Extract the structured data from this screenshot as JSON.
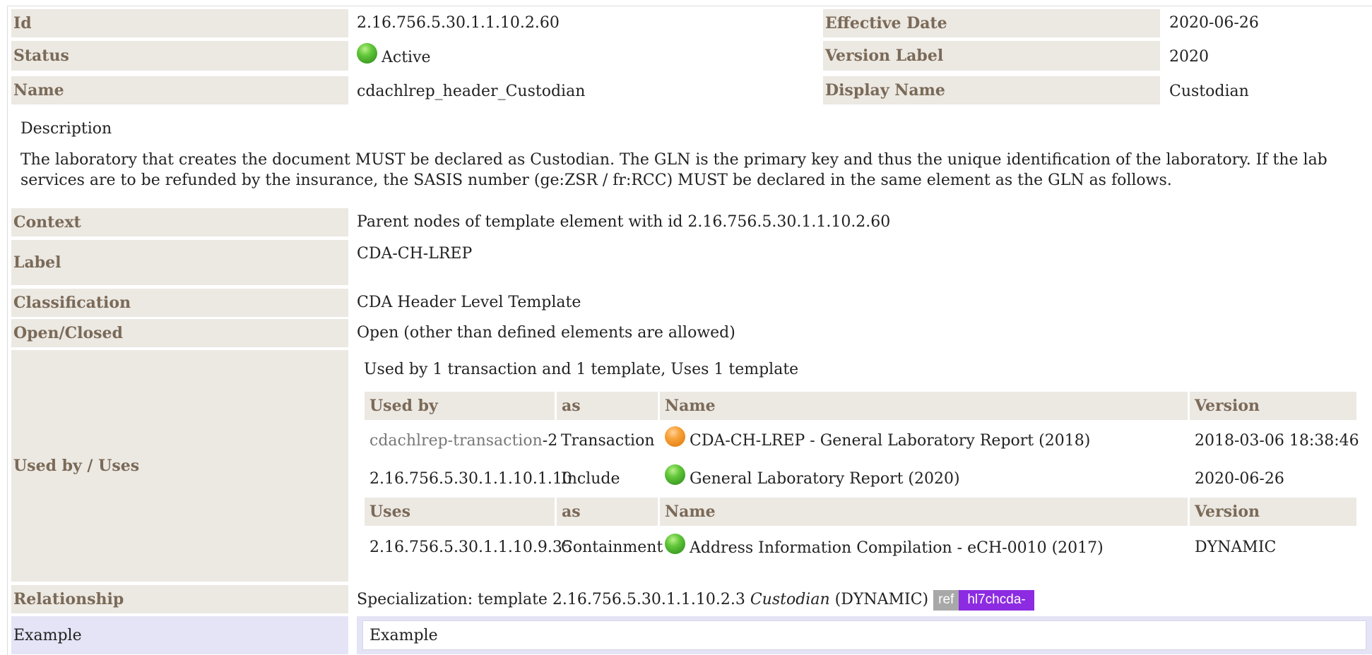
{
  "header": {
    "id_label": "Id",
    "id_value": "2.16.756.5.30.1.1.10.2.60",
    "effective_date_label": "Effective Date",
    "effective_date_value": "2020-06-26",
    "status_label": "Status",
    "status_value": "Active",
    "status_icon": "green-status-dot-icon",
    "version_label_label": "Version Label",
    "version_label_value": "2020",
    "name_label": "Name",
    "name_value": "cdachlrep_header_Custodian",
    "display_name_label": "Display Name",
    "display_name_value": "Custodian"
  },
  "description": {
    "heading": "Description",
    "text": "The laboratory that creates the document MUST be declared as Custodian. The GLN is the primary key and thus the unique identification of the laboratory. If the lab services are to be refunded by the insurance, the SASIS number (ge:ZSR / fr:RCC) MUST be declared in the same element as the GLN as follows."
  },
  "details": {
    "context_label": "Context",
    "context_value": "Parent nodes of template element with id 2.16.756.5.30.1.1.10.2.60",
    "label_label": "Label",
    "label_value": "CDA-CH-LREP",
    "classification_label": "Classification",
    "classification_value": "CDA Header Level Template",
    "open_closed_label": "Open/Closed",
    "open_closed_value": "Open (other than defined elements are allowed)",
    "used_by_uses_label": "Used by / Uses",
    "relationship_label": "Relationship",
    "example_label": "Example"
  },
  "usage": {
    "summary": "Used by 1 transaction and 1 template, Uses 1 template",
    "used_by_headers": [
      "Used by",
      "as",
      "Name",
      "Version"
    ],
    "used_by_rows": [
      {
        "ref": "cdachlrep-transaction",
        "ref_suffix": "-2",
        "as": "Transaction",
        "status_icon": "orange-status-dot-icon",
        "name": "CDA-CH-LREP - General Laboratory Report (2018)",
        "version": "2018-03-06 18:38:46"
      },
      {
        "ref": "2.16.756.5.30.1.1.10.1.10",
        "as": "Include",
        "status_icon": "green-status-dot-icon",
        "name": "General Laboratory Report (2020)",
        "version": "2020-06-26"
      }
    ],
    "uses_headers": [
      "Uses",
      "as",
      "Name",
      "Version"
    ],
    "uses_rows": [
      {
        "ref": "2.16.756.5.30.1.1.10.9.35",
        "as": "Containment",
        "status_icon": "green-status-dot-icon",
        "name": "Address Information Compilation - eCH-0010 (2017)",
        "version": "DYNAMIC"
      }
    ]
  },
  "relationship": {
    "prefix": "Specialization: template 2.16.756.5.30.1.1.10.2.3 ",
    "template_name": "Custodian",
    "suffix": " (DYNAMIC)",
    "badge_ref": "ref",
    "badge_prefix": "hl7chcda-"
  },
  "example": {
    "title": "Example"
  },
  "colors": {
    "label_bg": "#ece8e2",
    "label_text": "#7a6a58",
    "example_bg": "#e4e4f6",
    "badge_ref_bg": "#a8a8a8",
    "badge_prefix_bg": "#8c2be2",
    "status_active": "#4caf30",
    "status_draft": "#f09a2a"
  }
}
